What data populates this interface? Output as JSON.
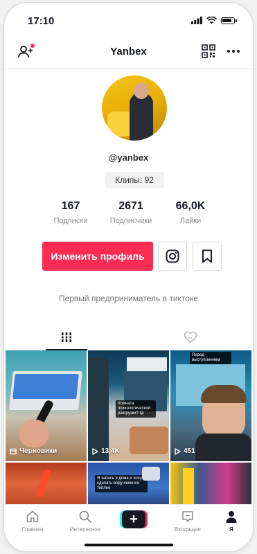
{
  "status": {
    "time": "17:10"
  },
  "header": {
    "title": "Yanbex"
  },
  "profile": {
    "username": "@yanbex",
    "clips_badge": "Клипы: 92",
    "stats": [
      {
        "value": "167",
        "label": "Подписки"
      },
      {
        "value": "2671",
        "label": "Подписчики"
      },
      {
        "value": "66,0K",
        "label": "Лайки"
      }
    ],
    "edit_button": "Изменить профиль",
    "bio": "Первый предприниматель в тиктоке"
  },
  "grid": {
    "tiles": [
      {
        "label": "Черновики",
        "label_icon": "drafts-icon"
      },
      {
        "label": "13,4K",
        "label_icon": "play-icon"
      },
      {
        "label": "451",
        "label_icon": "play-icon"
      }
    ]
  },
  "bottom_nav": [
    {
      "label": "Главная",
      "icon": "home-icon"
    },
    {
      "label": "Интересное",
      "icon": "search-icon"
    },
    {
      "label": "",
      "icon": "create-plus-icon"
    },
    {
      "label": "Входящие",
      "icon": "inbox-icon"
    },
    {
      "label": "Я",
      "icon": "profile-icon"
    }
  ],
  "colors": {
    "accent": "#fe2c55",
    "cyan": "#25f4ee",
    "text": "#161823",
    "muted": "#8a8b91"
  }
}
